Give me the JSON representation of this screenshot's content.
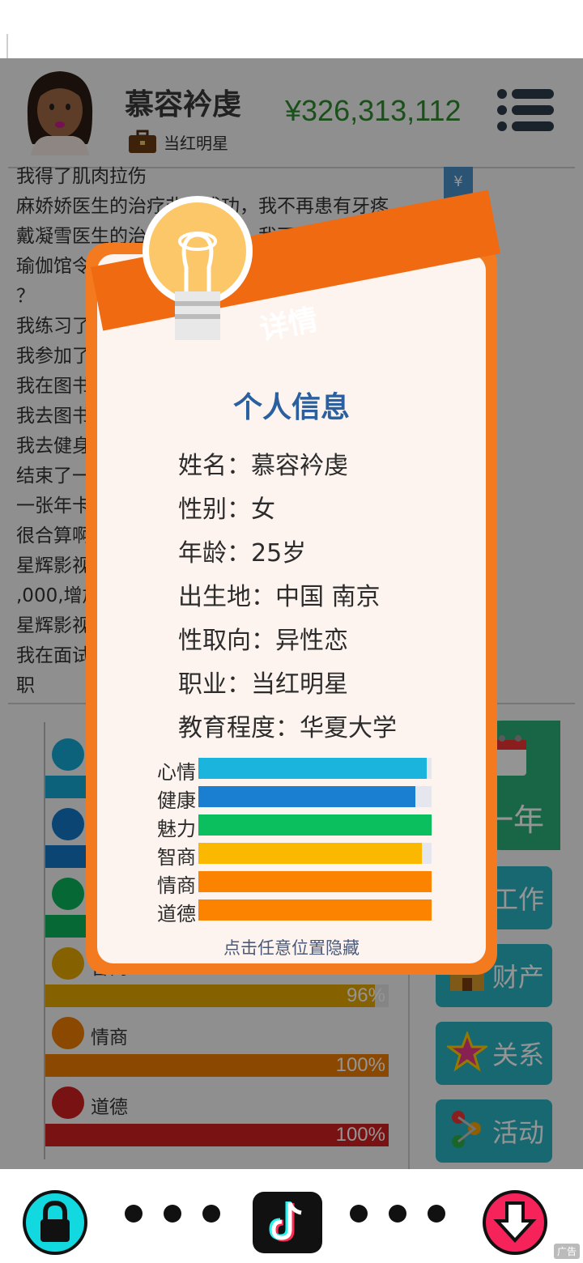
{
  "header": {
    "player_name": "慕容衿虔",
    "job": "当红明星",
    "money": "¥326,313,112"
  },
  "log_lines": [
    "我得了肌肉拉伤",
    "麻娇娇医生的治疗非常成功，我不再患有牙疼",
    "戴凝雪医生的治疗非常成功，我不再患有肌肉拉伤",
    "瑜伽馆令人放松的环境，让你参加吗\n？",
    "我练习了",
    "我参加了                                    练",
    "我在图书",
    "我去图书",
    "我去健身",
    "结束了一                                  不要办\n一张年卡                                  ）",
    "很合算啊",
    "星辉影视                                  ¥2,700\n,000,增加",
    "星辉影视",
    "我在面试                                  明星一\n职"
  ],
  "stats_bg": [
    {
      "label": "心情",
      "pct_text": "",
      "fill": 0.99,
      "color": "#17a9d4",
      "icon": "smiley-icon"
    },
    {
      "label": "健康",
      "pct_text": "",
      "fill": 0.94,
      "color": "#1277c6",
      "icon": "heart-icon"
    },
    {
      "label": "魅力",
      "pct_text": "",
      "fill": 1.0,
      "color": "#0bb35b",
      "icon": "sun-icon"
    },
    {
      "label": "智商",
      "pct_text": "96%",
      "fill": 0.96,
      "color": "#e6a800",
      "icon": "brain-icon"
    },
    {
      "label": "情商",
      "pct_text": "100%",
      "fill": 1.0,
      "color": "#f07c00",
      "icon": "apple-icon"
    },
    {
      "label": "道德",
      "pct_text": "100%",
      "fill": 1.0,
      "color": "#d01f1f",
      "icon": "scale-icon"
    }
  ],
  "side_buttons": {
    "year": "一年",
    "work": "工作",
    "assets": "财产",
    "relations": "关系",
    "activities": "活动"
  },
  "modal": {
    "ribbon": "详情",
    "title": "个人信息",
    "rows": [
      "姓名：慕容衿虔",
      "性别：女",
      "年龄：25岁",
      "出生地：中国 南京",
      "性取向：异性恋",
      "职业：当红明星",
      "教育程度：华夏大学"
    ],
    "bars": [
      {
        "label": "心情",
        "value": 0.98,
        "color": "#1ab4dc"
      },
      {
        "label": "健康",
        "value": 0.93,
        "color": "#1a7fd0"
      },
      {
        "label": "魅力",
        "value": 1.0,
        "color": "#0bbf5e"
      },
      {
        "label": "智商",
        "value": 0.96,
        "color": "#fbb800"
      },
      {
        "label": "情商",
        "value": 1.0,
        "color": "#fb8300"
      },
      {
        "label": "道德",
        "value": 1.0,
        "color": "#fb8300"
      }
    ],
    "hint": "点击任意位置隐藏"
  },
  "bottom": {
    "ad_label": "广告"
  }
}
